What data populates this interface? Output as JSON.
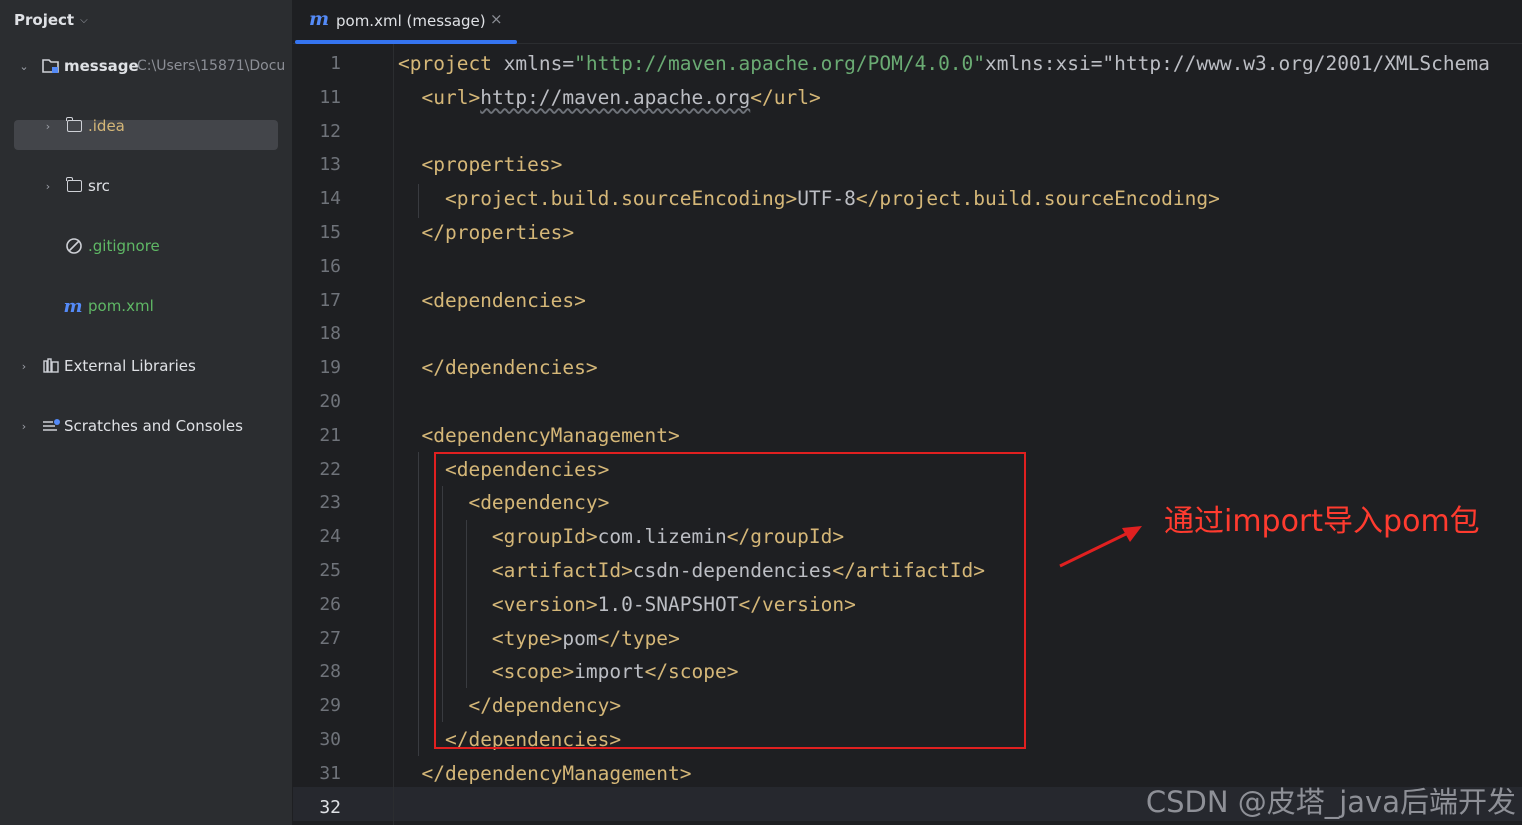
{
  "sidebar": {
    "title": "Project",
    "tree": [
      {
        "label": "message",
        "path": "C:\\Users\\15871\\Docu",
        "icon": "module-folder-icon"
      },
      {
        "label": ".idea",
        "icon": "folder-icon"
      },
      {
        "label": "src",
        "icon": "folder-icon"
      },
      {
        "label": ".gitignore",
        "icon": "ignore-file-icon"
      },
      {
        "label": "pom.xml",
        "icon": "maven-file-icon"
      },
      {
        "label": "External Libraries",
        "icon": "libraries-icon"
      },
      {
        "label": "Scratches and Consoles",
        "icon": "scratches-icon"
      }
    ]
  },
  "tab": {
    "icon_glyph": "m",
    "label": "pom.xml (message)",
    "close_glyph": "×"
  },
  "editor": {
    "lines": [
      {
        "n": "1",
        "text": "<project xmlns=\"http://maven.apache.org/POM/4.0.0\" xmlns:xsi=\"http://www.w3.org/2001/XMLSchema"
      },
      {
        "n": "11",
        "text": "  <url>http://maven.apache.org</url>"
      },
      {
        "n": "12",
        "text": ""
      },
      {
        "n": "13",
        "text": "  <properties>"
      },
      {
        "n": "14",
        "text": "    <project.build.sourceEncoding>UTF-8</project.build.sourceEncoding>"
      },
      {
        "n": "15",
        "text": "  </properties>"
      },
      {
        "n": "16",
        "text": ""
      },
      {
        "n": "17",
        "text": "  <dependencies>"
      },
      {
        "n": "18",
        "text": ""
      },
      {
        "n": "19",
        "text": "  </dependencies>"
      },
      {
        "n": "20",
        "text": ""
      },
      {
        "n": "21",
        "text": "  <dependencyManagement>"
      },
      {
        "n": "22",
        "text": "    <dependencies>"
      },
      {
        "n": "23",
        "text": "      <dependency>"
      },
      {
        "n": "24",
        "text": "        <groupId>com.lizemin</groupId>"
      },
      {
        "n": "25",
        "text": "        <artifactId>csdn-dependencies</artifactId>"
      },
      {
        "n": "26",
        "text": "        <version>1.0-SNAPSHOT</version>"
      },
      {
        "n": "27",
        "text": "        <type>pom</type>"
      },
      {
        "n": "28",
        "text": "        <scope>import</scope>"
      },
      {
        "n": "29",
        "text": "      </dependency>"
      },
      {
        "n": "30",
        "text": "    </dependencies>"
      },
      {
        "n": "31",
        "text": "  </dependencyManagement>"
      },
      {
        "n": "32",
        "text": ""
      }
    ],
    "active_line": "32"
  },
  "annotation": {
    "text": "通过import导入pom包",
    "color": "#ff3b2f"
  },
  "watermark": "CSDN @皮塔_java后端开发"
}
